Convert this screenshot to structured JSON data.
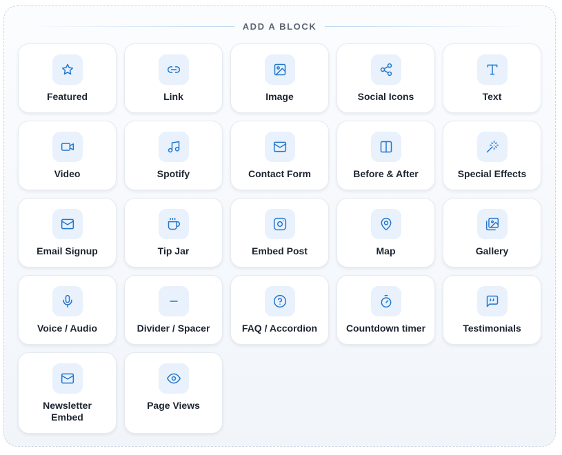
{
  "header": {
    "title": "ADD A BLOCK"
  },
  "blocks": [
    {
      "label": "Featured",
      "icon": "star-icon"
    },
    {
      "label": "Link",
      "icon": "link-icon"
    },
    {
      "label": "Image",
      "icon": "image-icon"
    },
    {
      "label": "Social Icons",
      "icon": "share-icon"
    },
    {
      "label": "Text",
      "icon": "text-icon"
    },
    {
      "label": "Video",
      "icon": "video-icon"
    },
    {
      "label": "Spotify",
      "icon": "music-icon"
    },
    {
      "label": "Contact Form",
      "icon": "mail-icon"
    },
    {
      "label": "Before & After",
      "icon": "split-icon"
    },
    {
      "label": "Special Effects",
      "icon": "magic-wand-icon"
    },
    {
      "label": "Email Signup",
      "icon": "mail-icon"
    },
    {
      "label": "Tip Jar",
      "icon": "coffee-icon"
    },
    {
      "label": "Embed Post",
      "icon": "instagram-icon"
    },
    {
      "label": "Map",
      "icon": "map-pin-icon"
    },
    {
      "label": "Gallery",
      "icon": "gallery-icon"
    },
    {
      "label": "Voice / Audio",
      "icon": "microphone-icon"
    },
    {
      "label": "Divider / Spacer",
      "icon": "minus-icon"
    },
    {
      "label": "FAQ / Accordion",
      "icon": "question-icon"
    },
    {
      "label": "Countdown timer",
      "icon": "timer-icon"
    },
    {
      "label": "Testimonials",
      "icon": "quote-icon"
    },
    {
      "label": "Newsletter Embed",
      "icon": "mail-icon"
    },
    {
      "label": "Page Views",
      "icon": "eye-icon"
    }
  ],
  "colors": {
    "accent": "#2277cc",
    "icon_bg": "#e8f1fc",
    "text": "#1c2430",
    "header_text": "#5b6675"
  }
}
